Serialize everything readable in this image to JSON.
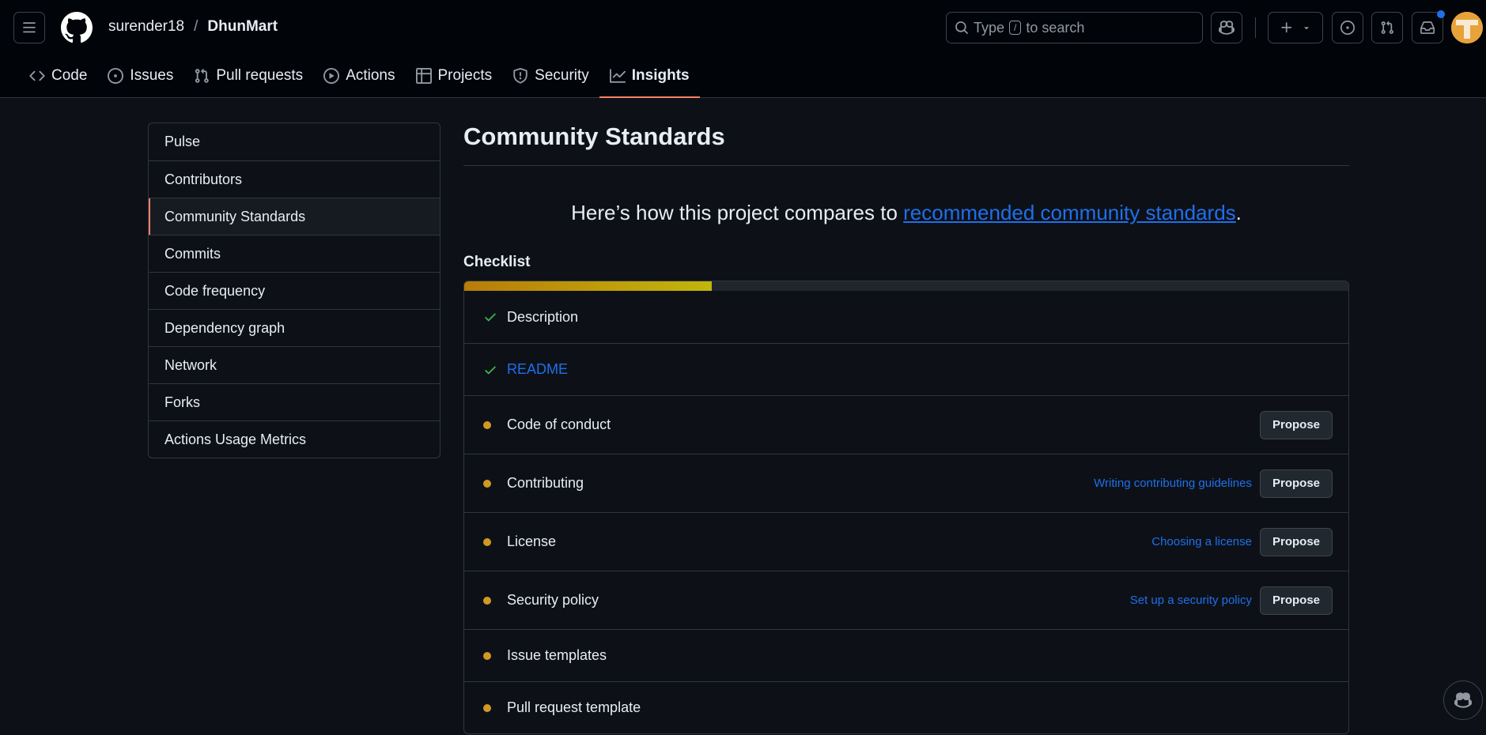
{
  "header": {
    "owner": "surender18",
    "separator": "/",
    "repo": "DhunMart",
    "search": {
      "prefix": "Type",
      "key": "/",
      "suffix": "to search"
    }
  },
  "tabs": [
    {
      "label": "Code",
      "icon": "code-icon"
    },
    {
      "label": "Issues",
      "icon": "issue-icon"
    },
    {
      "label": "Pull requests",
      "icon": "pull-request-icon"
    },
    {
      "label": "Actions",
      "icon": "play-icon"
    },
    {
      "label": "Projects",
      "icon": "table-icon"
    },
    {
      "label": "Security",
      "icon": "shield-icon"
    },
    {
      "label": "Insights",
      "icon": "graph-icon",
      "active": true
    }
  ],
  "sidebar": {
    "items": [
      {
        "label": "Pulse"
      },
      {
        "label": "Contributors"
      },
      {
        "label": "Community Standards",
        "active": true
      },
      {
        "label": "Commits"
      },
      {
        "label": "Code frequency"
      },
      {
        "label": "Dependency graph"
      },
      {
        "label": "Network"
      },
      {
        "label": "Forks"
      },
      {
        "label": "Actions Usage Metrics"
      }
    ]
  },
  "main": {
    "title": "Community Standards",
    "lead_before": "Here’s how this project compares to ",
    "lead_link": "recommended community standards",
    "lead_after": ".",
    "checklist_title": "Checklist",
    "progress": 0.28,
    "rows": [
      {
        "label": "Description",
        "status": "done",
        "is_link": false,
        "help": "",
        "action": ""
      },
      {
        "label": "README",
        "status": "done",
        "is_link": true,
        "help": "",
        "action": ""
      },
      {
        "label": "Code of conduct",
        "status": "todo",
        "is_link": false,
        "help": "",
        "action": "Propose"
      },
      {
        "label": "Contributing",
        "status": "todo",
        "is_link": false,
        "help": "Writing contributing guidelines",
        "action": "Propose"
      },
      {
        "label": "License",
        "status": "todo",
        "is_link": false,
        "help": "Choosing a license",
        "action": "Propose"
      },
      {
        "label": "Security policy",
        "status": "todo",
        "is_link": false,
        "help": "Set up a security policy",
        "action": "Propose"
      },
      {
        "label": "Issue templates",
        "status": "todo",
        "is_link": false,
        "help": "",
        "action": ""
      },
      {
        "label": "Pull request template",
        "status": "todo",
        "is_link": false,
        "help": "",
        "action": ""
      }
    ]
  },
  "colors": {
    "accent": "#f78166",
    "link": "#1f6feb",
    "done": "#3fb950",
    "todo": "#d29922"
  }
}
